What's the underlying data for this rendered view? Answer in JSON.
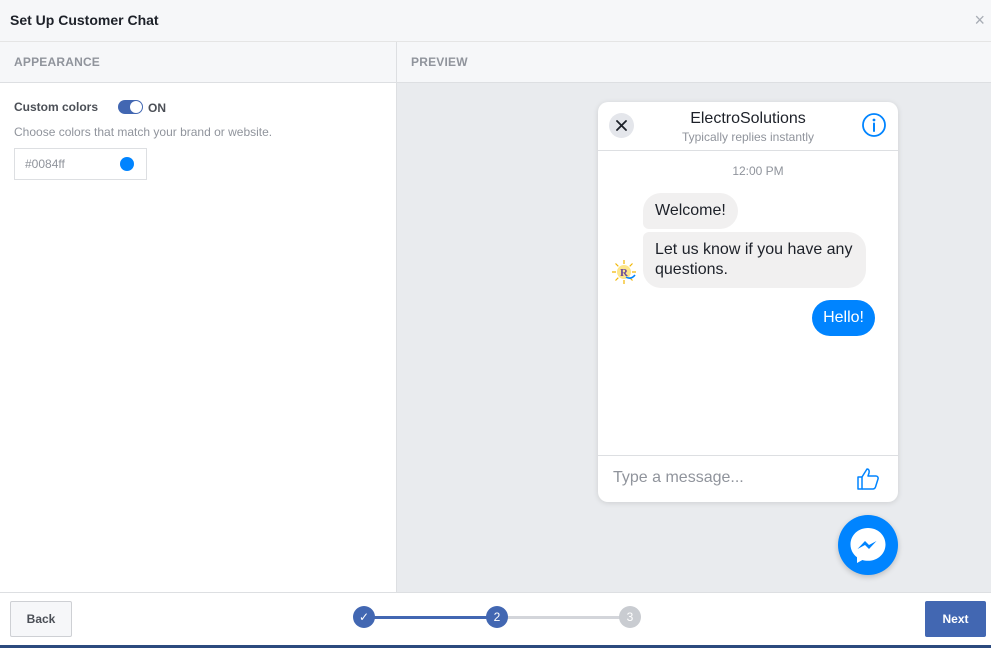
{
  "dialog": {
    "title": "Set Up Customer Chat",
    "close_icon": "×"
  },
  "columns": {
    "appearance": "APPEARANCE",
    "preview": "PREVIEW"
  },
  "appearance": {
    "custom_colors_label": "Custom colors",
    "toggle_state": "ON",
    "hint": "Choose colors that match your brand or website.",
    "color_value": "#0084ff",
    "color_swatch": "#0084ff"
  },
  "chat_preview": {
    "page_name": "ElectroSolutions",
    "reply_status": "Typically replies instantly",
    "timestamp": "12:00 PM",
    "incoming": [
      "Welcome!",
      "Let us know if you have any questions."
    ],
    "outgoing": "Hello!",
    "composer_placeholder": "Type a message...",
    "icons": {
      "close": "close-icon",
      "info": "info-icon",
      "like": "thumbs-up-icon",
      "messenger": "messenger-icon"
    }
  },
  "footer": {
    "back_label": "Back",
    "next_label": "Next",
    "steps": [
      "✓",
      "2",
      "3"
    ],
    "current_step": 2
  },
  "colors": {
    "brand": "#4267b2",
    "messenger_blue": "#0084ff"
  }
}
